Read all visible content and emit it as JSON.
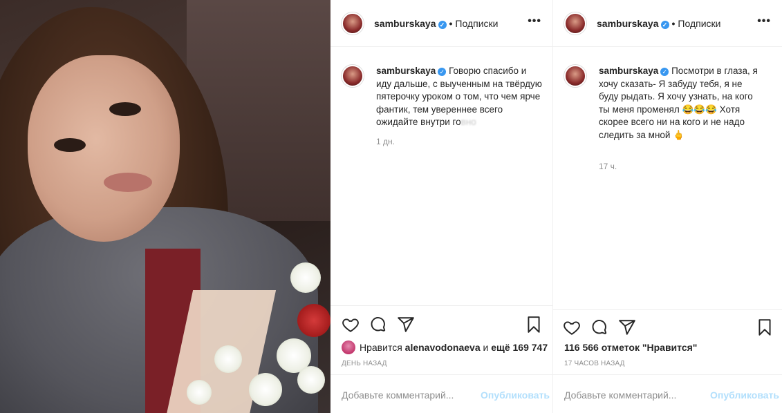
{
  "photo": {
    "alt": ""
  },
  "post1": {
    "header": {
      "username": "samburskaya",
      "separator": "•",
      "follow": "Подписки",
      "more": "•••"
    },
    "caption": {
      "username": "samburskaya",
      "text": "Говорю спасибо и иду дальше, с выученным на твёрдую пятерочку уроком о том, что чем ярче фантик, тем увереннее всего ожидайте внутри го",
      "blurred": "вно"
    },
    "time": "1 дн.",
    "likes": {
      "prefix": "Нравится",
      "user": "alenavodonaeva",
      "middle": "и",
      "rest": "ещё 169 747"
    },
    "ago": "ДЕНЬ НАЗАД",
    "comment": {
      "placeholder": "Добавьте комментарий...",
      "publish": "Опубликовать"
    }
  },
  "post2": {
    "header": {
      "username": "samburskaya",
      "separator": "•",
      "follow": "Подписки",
      "more": "•••"
    },
    "caption": {
      "username": "samburskaya",
      "text": "Посмотри в глаза, я хочу сказать- Я забуду тебя, я не буду рыдать. Я хочу узнать, на кого ты меня променял 😂😂😂 Хотя скорее всего ни на кого и не надо следить за мной 🖕"
    },
    "time": "17 ч.",
    "likes": {
      "text": "116 566 отметок \"Нравится\""
    },
    "ago": "17 ЧАСОВ НАЗАД",
    "comment": {
      "placeholder": "Добавьте комментарий...",
      "publish": "Опубликовать"
    }
  },
  "colors": {
    "verified": "#3897f0",
    "muted": "#8e8e8e",
    "publish": "#b2dffc",
    "border": "#efefef"
  },
  "icons": [
    "heart-icon",
    "comment-icon",
    "share-icon",
    "bookmark-icon",
    "verified-icon"
  ]
}
